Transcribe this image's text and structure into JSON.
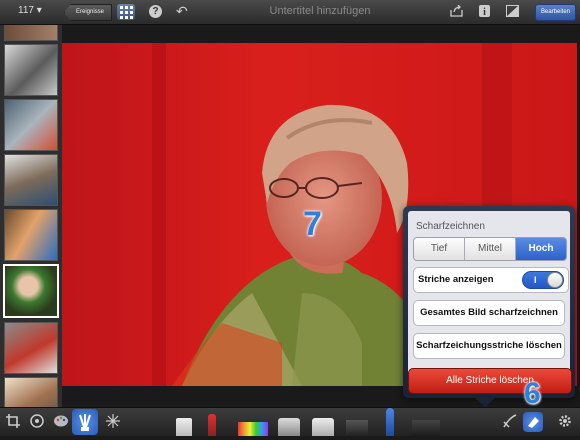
{
  "topbar": {
    "photo_count": "117 ▾",
    "back_label": "Ereignisse",
    "title_placeholder": "Untertitel hinzufügen",
    "edit_label": "Bearbeiten"
  },
  "sidebar": {
    "thumbnails": [
      "thumb-1",
      "thumb-2",
      "thumb-3",
      "thumb-4",
      "thumb-5",
      "thumb-6",
      "thumb-7",
      "thumb-8"
    ]
  },
  "popover": {
    "title": "Scharfzeichnen",
    "strength_options": [
      "Tief",
      "Mittel",
      "Hoch"
    ],
    "strength_selected": "Hoch",
    "show_strokes_label": "Striche anzeigen",
    "show_strokes_on": true,
    "toggle_on_mark": "I",
    "sharpen_all_label": "Gesamtes Bild scharfzeichnen",
    "clear_strokes_label": "Scharfzeichungsstriche löschen",
    "delete_all_label": "Alle Striche löschen"
  },
  "badges": {
    "badge_7": "7",
    "badge_6": "6"
  },
  "colors": {
    "accent_blue": "#2d61c9",
    "overlay_red": "#d11a1a",
    "delete_red": "#c01e12",
    "badge_blue": "#2d7fe0"
  }
}
